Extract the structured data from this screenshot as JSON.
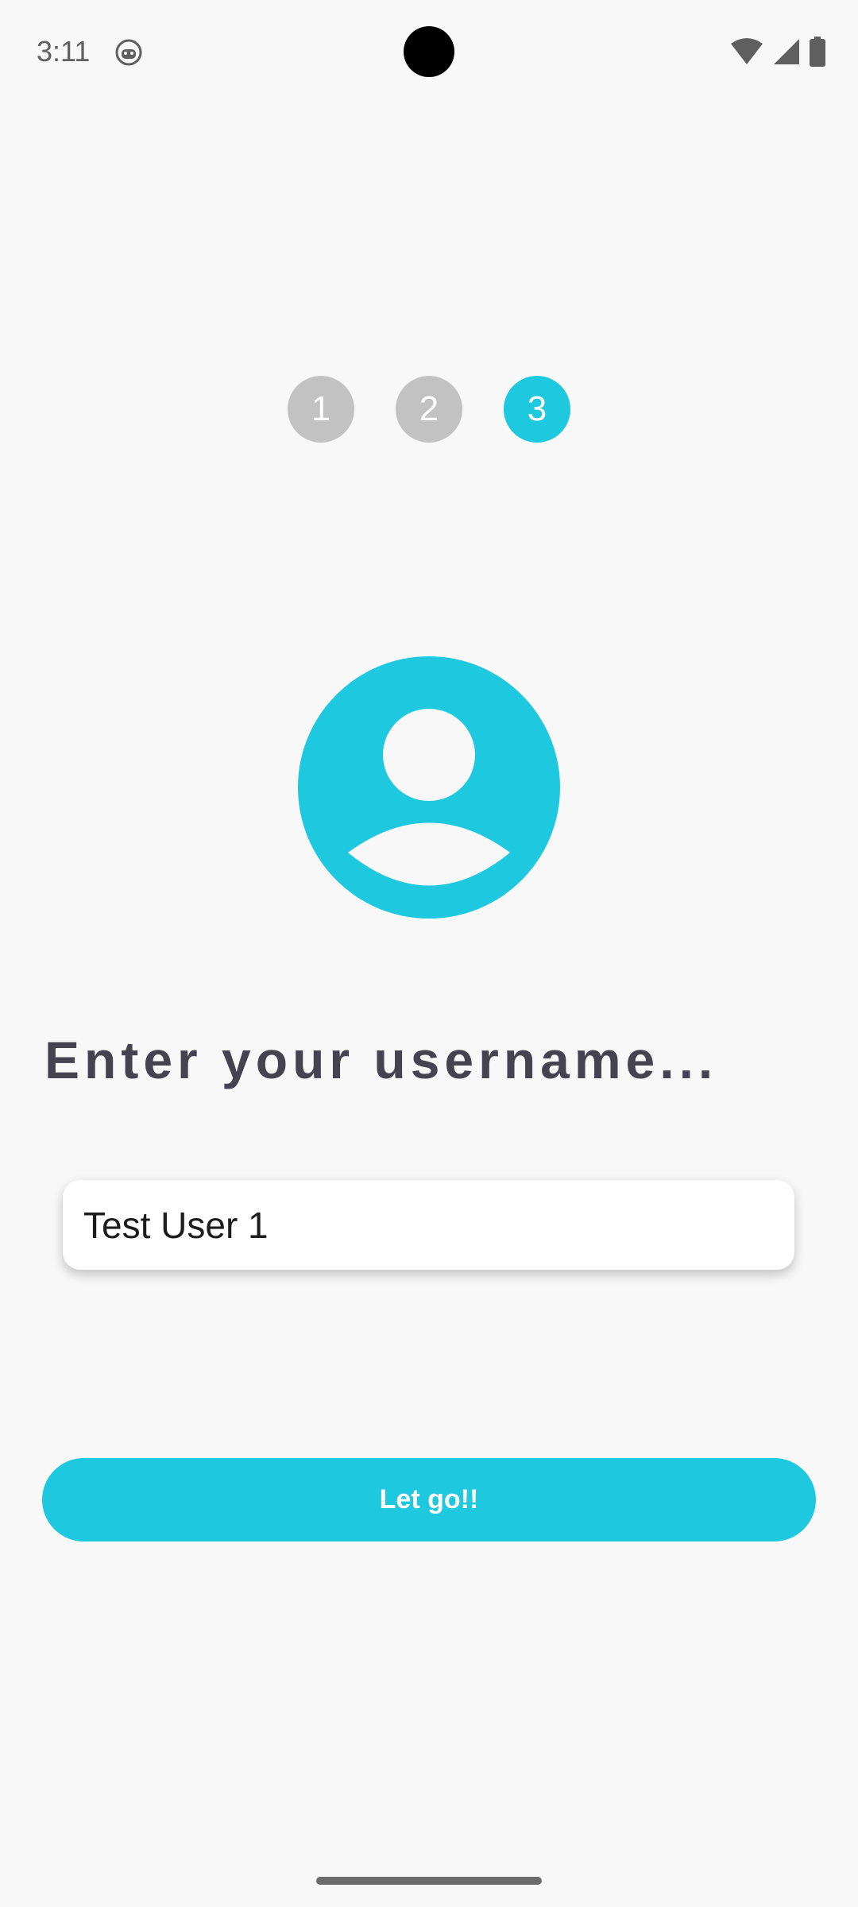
{
  "status_bar": {
    "time": "3:11",
    "app_icon": "android-debug-icon",
    "wifi_icon": "wifi-icon",
    "signal_icon": "cell-signal-icon",
    "battery_icon": "battery-icon"
  },
  "steps": [
    {
      "label": "1",
      "active": false
    },
    {
      "label": "2",
      "active": false
    },
    {
      "label": "3",
      "active": true
    }
  ],
  "avatar_icon": "account-circle-icon",
  "heading": "Enter your username...",
  "username_input": {
    "value": "Test User 1",
    "placeholder": ""
  },
  "submit_button": {
    "label": "Let go!!"
  },
  "colors": {
    "accent": "#1ec8de",
    "inactive_step": "#c2c2c2",
    "heading_text": "#45434f",
    "background": "#f8f8f8"
  }
}
